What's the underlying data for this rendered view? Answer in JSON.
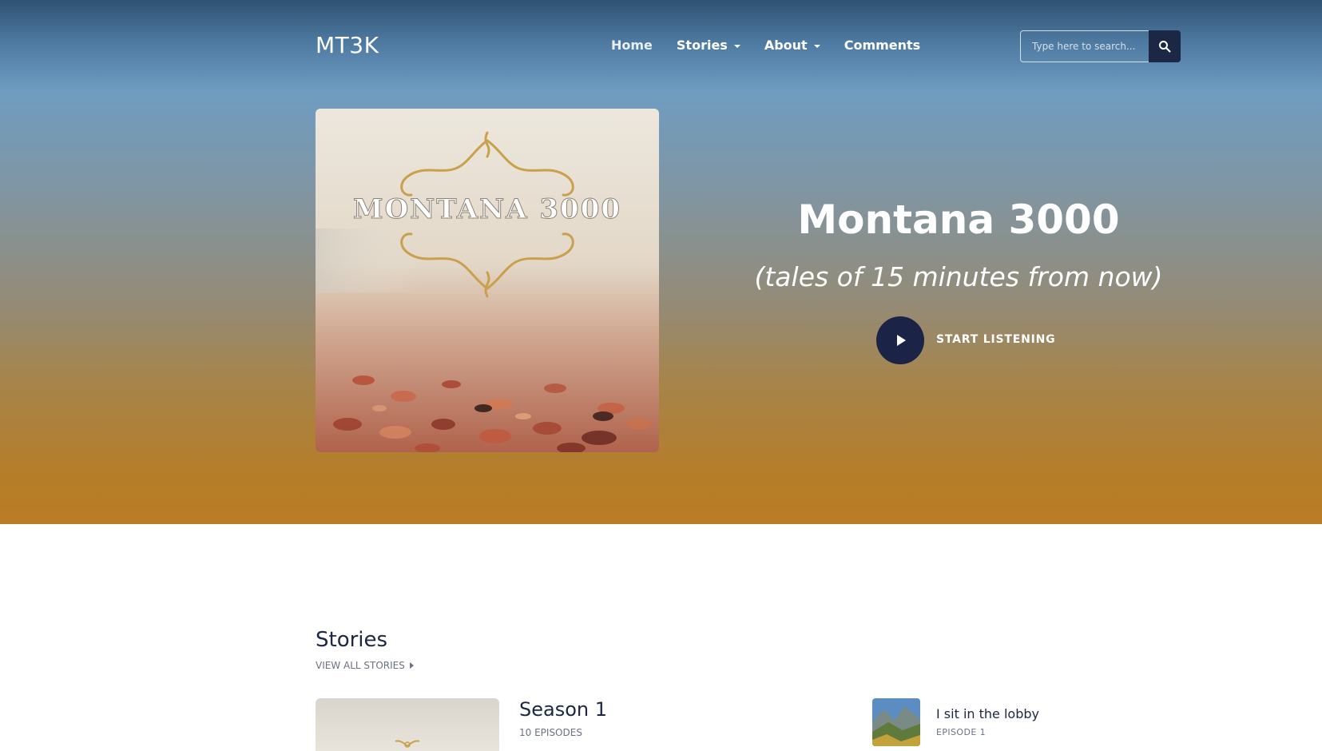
{
  "brand": {
    "logo": "MT3K"
  },
  "nav": {
    "items": [
      {
        "label": "Home"
      },
      {
        "label": "Stories"
      },
      {
        "label": "About"
      },
      {
        "label": "Comments"
      }
    ]
  },
  "search": {
    "placeholder": "Type here to search..."
  },
  "hero": {
    "cover_text": "MONTANA 3000",
    "title": "Montana 3000",
    "subtitle": "(tales of 15 minutes from now)",
    "cta_label": "START LISTENING"
  },
  "stories": {
    "heading": "Stories",
    "view_all_label": "VIEW ALL STORIES",
    "seasons": [
      {
        "title": "Season 1",
        "episodes_label": "10 EPISODES"
      }
    ],
    "episodes": [
      {
        "title": "I sit in the lobby",
        "episode_label": "EPISODE 1"
      }
    ]
  },
  "colors": {
    "accent": "#1b2446",
    "hero_top": "#2f5272",
    "hero_bottom": "#bb7c25"
  },
  "icons": {
    "search": "search-icon",
    "play": "play-icon",
    "dropdown": "chevron-down-icon",
    "view_all": "chevron-right-icon"
  }
}
